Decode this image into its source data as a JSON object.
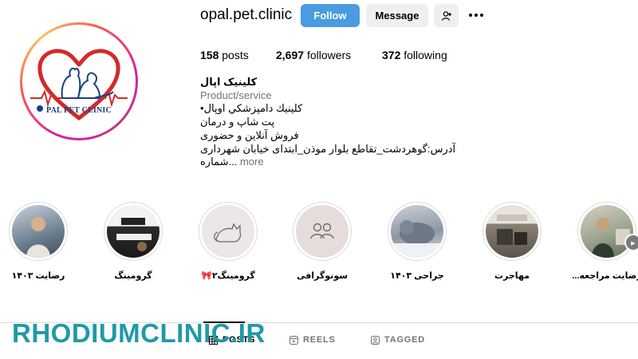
{
  "profile": {
    "username": "opal.pet.clinic",
    "logo_text": "PAL PET CLINIC",
    "follow_label": "Follow",
    "message_label": "Message"
  },
  "stats": {
    "posts_count": "158",
    "posts_label": "posts",
    "followers_count": "2,697",
    "followers_label": "followers",
    "following_count": "372",
    "following_label": "following"
  },
  "bio": {
    "name": "کلینیک اپال",
    "category": "Product/service",
    "lines": [
      "•کلینیك دامپزشکي اوپال",
      "پت شاپ و درمان",
      "فروش آنلاین و حضوری",
      "آدرس:گوهردشت_تقاطع بلوار موذن_ابتدای خیابان شهرداری"
    ],
    "last_line": "شماره...",
    "more_label": "more"
  },
  "highlights": [
    {
      "label": "رضایت ۱۴۰۳",
      "bg": "#9aa7b8"
    },
    {
      "label": "گرومینگ",
      "bg": "#3a3a3a"
    },
    {
      "label": "گرومینگ۲🎀",
      "bg": "#ece6e6"
    },
    {
      "label": "سونوگرافی",
      "bg": "#e6dcdc"
    },
    {
      "label": "جراحی ۱۴۰۳",
      "bg": "#8d96a3"
    },
    {
      "label": "مهاجرت",
      "bg": "#c9c2b8"
    },
    {
      "label": "رضایت مراجعه...",
      "bg": "#8aa08a"
    }
  ],
  "tabs": {
    "posts": "POSTS",
    "reels": "REELS",
    "tagged": "TAGGED"
  },
  "watermark": "RHODIUMCLINIC.IR",
  "colors": {
    "follow_button": "#4a9be0",
    "watermark": "#1f9aa7",
    "logo_red": "#d32a2a",
    "logo_blue": "#1b3f88"
  }
}
